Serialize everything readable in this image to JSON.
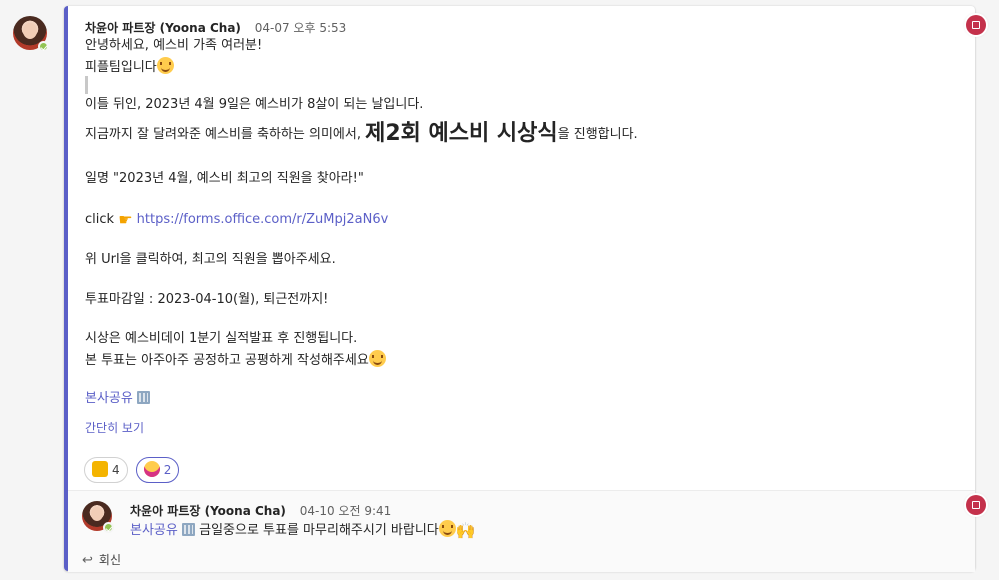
{
  "post": {
    "author": "차윤아 파트장 (Yoona Cha)",
    "timestamp": "04-07 오후 5:53",
    "lines": {
      "l1": "안녕하세요, 예스비 가족 여러분!",
      "l2": "피플팀입니다",
      "l3": "이틀 뒤인, 2023년 4월 9일은 예스비가 8살이 되는 날입니다.",
      "l4a": "지금까지 잘 달려와준 예스비를 축하하는 의미에서, ",
      "l4big": "제2회 예스비 시상식",
      "l4b": "을 진행합니다.",
      "l5": "일명 \"2023년 4월, 예스비 최고의 직원을 찾아라!\"",
      "l6a": "click ",
      "l6link": "https://forms.office.com/r/ZuMpj2aN6v",
      "l7": "위 Url을 클릭하여, 최고의 직원을 뽑아주세요.",
      "l8": "투표마감일 : 2023-04-10(월), 퇴근전까지!",
      "l9": "시상은 예스비데이 1분기 실적발표 후 진행됩니다.",
      "l10": "본 투표는 아주아주 공정하고 공평하게 작성해주세요",
      "mention": "본사공유"
    },
    "see_less": "간단히 보기",
    "reactions": [
      {
        "emoji": "thumbs-up",
        "count": "4"
      },
      {
        "emoji": "laughing-face",
        "count": "2"
      }
    ]
  },
  "reply": {
    "author": "차윤아 파트장 (Yoona Cha)",
    "timestamp": "04-10 오전 9:41",
    "mention": "본사공유",
    "text": " 금일중으로 투표를 마무리해주시기 바랍니다"
  },
  "reply_button": "회신",
  "colors": {
    "accent": "#5b5fc7",
    "background": "#f5f5f5",
    "card": "#ffffff",
    "menu_icon": "#c4314b",
    "presence": "#92c353"
  }
}
